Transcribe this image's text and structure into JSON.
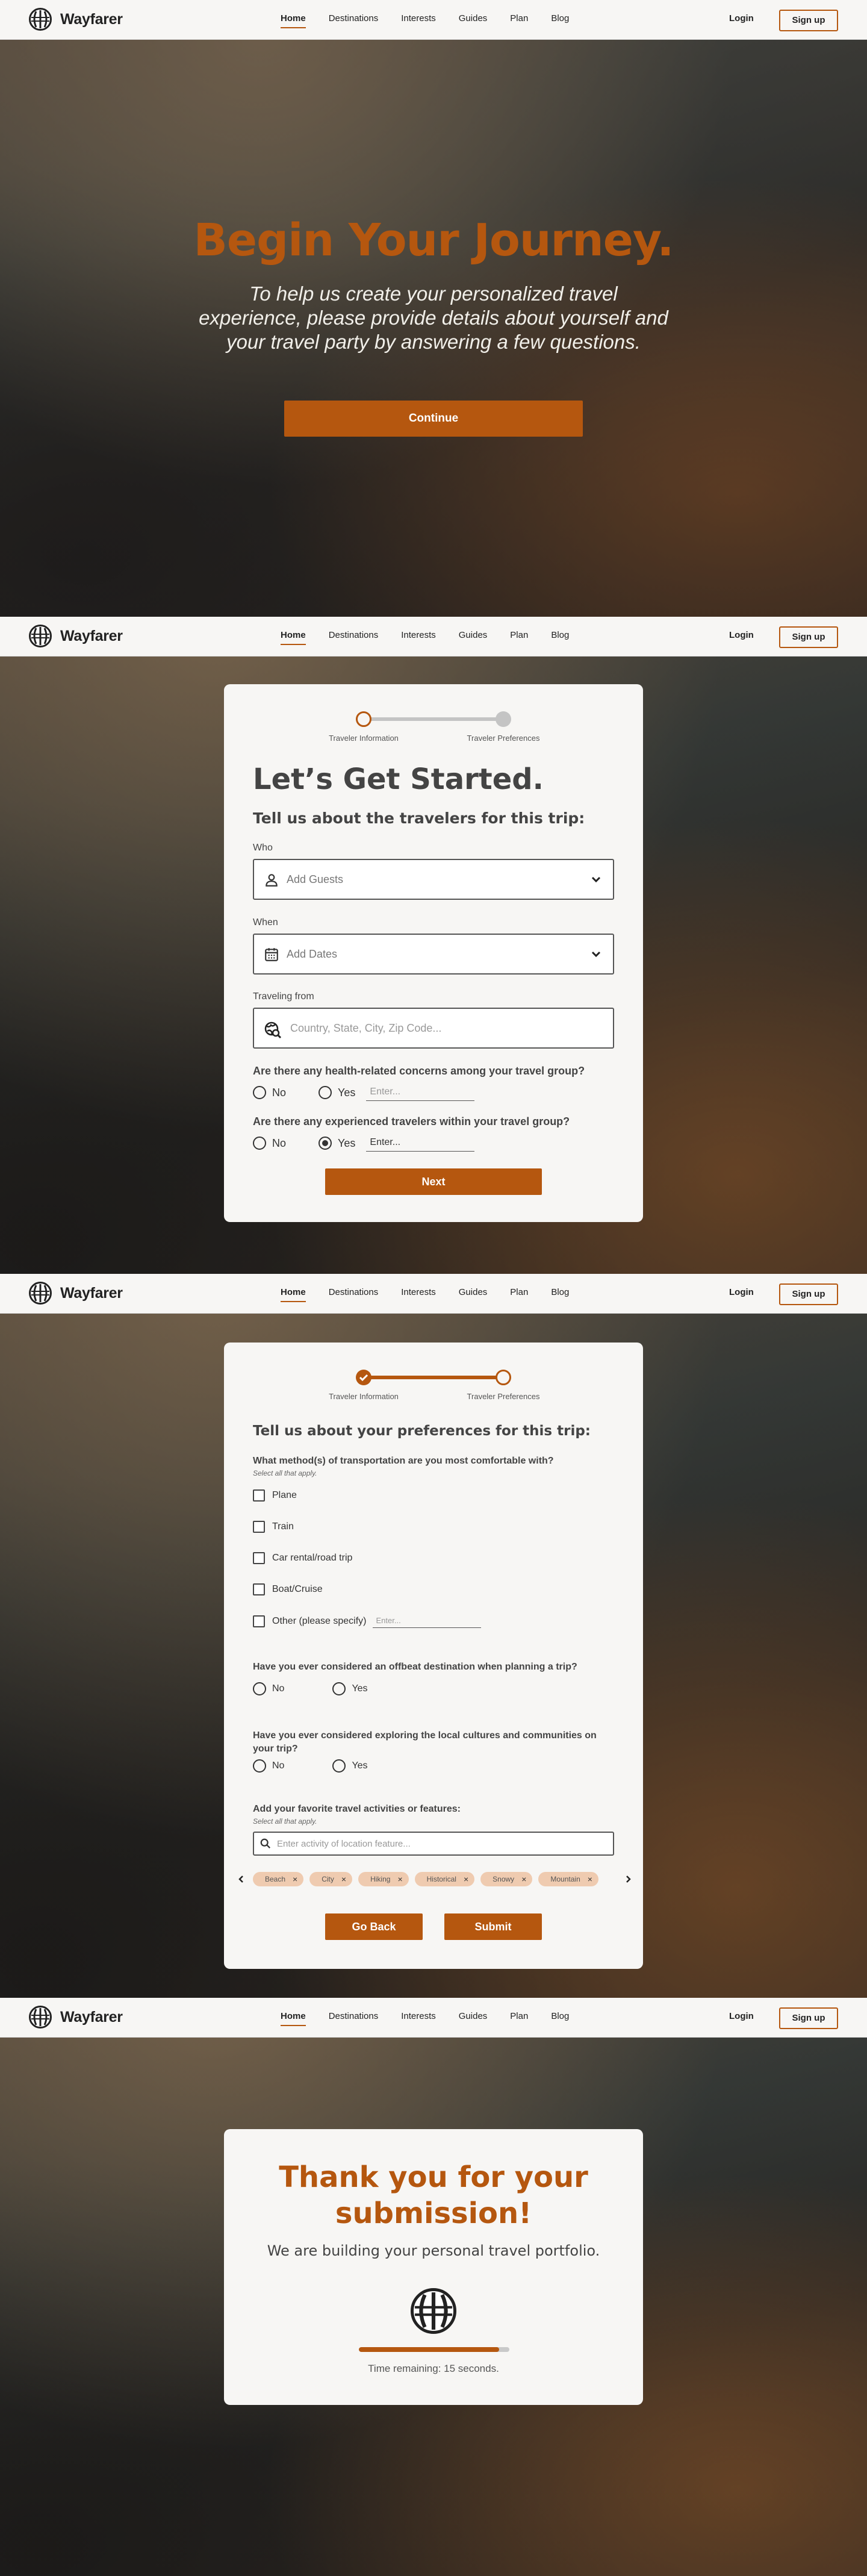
{
  "brand": {
    "name": "Wayfarer"
  },
  "nav": {
    "links": [
      "Home",
      "Destinations",
      "Interests",
      "Guides",
      "Plan",
      "Blog"
    ],
    "login": "Login",
    "signup": "Sign up"
  },
  "hero": {
    "title": "Begin Your Journey.",
    "subtitle": "To help us create your personalized travel experience, please provide details about yourself and your travel party by answering a few questions.",
    "cta": "Continue"
  },
  "stepper": {
    "step1": "Traveler Information",
    "step2": "Traveler Preferences"
  },
  "step1": {
    "title": "Let’s Get Started.",
    "subtitle": "Tell us about the travelers for this trip:",
    "who_label": "Who",
    "who_placeholder": "Add Guests",
    "when_label": "When",
    "when_placeholder": "Add Dates",
    "from_label": "Traveling from",
    "from_placeholder": "Country, State, City, Zip Code...",
    "q_health": "Are there any health-related concerns among your travel group?",
    "q_experienced": "Are there any experienced travelers within your travel group?",
    "no": "No",
    "yes": "Yes",
    "enter": "Enter...",
    "next": "Next"
  },
  "step2": {
    "subtitle": "Tell us about your preferences for this trip:",
    "q_transport": "What method(s) of transportation are you most comfortable with?",
    "select_all": "Select all that apply.",
    "transport_options": [
      "Plane",
      "Train",
      "Car rental/road trip",
      "Boat/Cruise",
      "Other (please specify)"
    ],
    "enter": "Enter...",
    "q_offbeat": "Have you ever considered an offbeat destination when planning a trip?",
    "q_local": "Have you ever considered exploring the local cultures and communities on your trip?",
    "no": "No",
    "yes": "Yes",
    "q_activities": "Add your favorite travel activities or features:",
    "activity_placeholder": "Enter activity of location feature...",
    "chips": [
      "Beach",
      "City",
      "Hiking",
      "Historical",
      "Snowy",
      "Mountain"
    ],
    "back": "Go Back",
    "submit": "Submit"
  },
  "thanks": {
    "title_line1": "Thank you for your",
    "title_line2": "submission!",
    "subtitle": "We are building your personal travel portfolio.",
    "progress": 0.93,
    "time_remaining": "Time remaining: 15 seconds."
  },
  "colors": {
    "accent": "#b5570f",
    "card": "#f7f6f4",
    "chip": "#efcbb0",
    "progress_track": "#c9c9c9"
  }
}
